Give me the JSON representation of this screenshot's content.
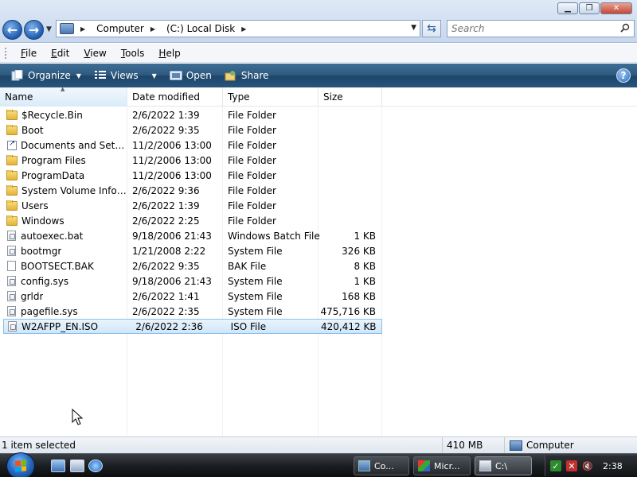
{
  "window": {
    "minimize": "▁",
    "maximize": "❐",
    "close": "✕"
  },
  "address": {
    "crumbs": [
      "Computer",
      "(C:) Local Disk"
    ]
  },
  "search": {
    "placeholder": "Search"
  },
  "menu": {
    "items": [
      {
        "accel": "F",
        "rest": "ile"
      },
      {
        "accel": "E",
        "rest": "dit"
      },
      {
        "accel": "V",
        "rest": "iew"
      },
      {
        "accel": "T",
        "rest": "ools"
      },
      {
        "accel": "H",
        "rest": "elp"
      }
    ]
  },
  "commands": {
    "organize": "Organize",
    "views": "Views",
    "open": "Open",
    "share": "Share",
    "help": "?"
  },
  "columns": {
    "name": "Name",
    "date": "Date modified",
    "type": "Type",
    "size": "Size"
  },
  "files": [
    {
      "name": "$Recycle.Bin",
      "date": "2/6/2022 1:39",
      "type": "File Folder",
      "size": "",
      "icon": "folder"
    },
    {
      "name": "Boot",
      "date": "2/6/2022 9:35",
      "type": "File Folder",
      "size": "",
      "icon": "folder"
    },
    {
      "name": "Documents and Settings",
      "date": "11/2/2006 13:00",
      "type": "File Folder",
      "size": "",
      "icon": "shortcut"
    },
    {
      "name": "Program Files",
      "date": "11/2/2006 13:00",
      "type": "File Folder",
      "size": "",
      "icon": "folder"
    },
    {
      "name": "ProgramData",
      "date": "11/2/2006 13:00",
      "type": "File Folder",
      "size": "",
      "icon": "folder"
    },
    {
      "name": "System Volume Inform...",
      "date": "2/6/2022 9:36",
      "type": "File Folder",
      "size": "",
      "icon": "folder"
    },
    {
      "name": "Users",
      "date": "2/6/2022 1:39",
      "type": "File Folder",
      "size": "",
      "icon": "folder"
    },
    {
      "name": "Windows",
      "date": "2/6/2022 2:25",
      "type": "File Folder",
      "size": "",
      "icon": "folder"
    },
    {
      "name": "autoexec.bat",
      "date": "9/18/2006 21:43",
      "type": "Windows Batch File",
      "size": "1 KB",
      "icon": "sysfile"
    },
    {
      "name": "bootmgr",
      "date": "1/21/2008 2:22",
      "type": "System File",
      "size": "326 KB",
      "icon": "sysfile"
    },
    {
      "name": "BOOTSECT.BAK",
      "date": "2/6/2022 9:35",
      "type": "BAK File",
      "size": "8 KB",
      "icon": "file"
    },
    {
      "name": "config.sys",
      "date": "9/18/2006 21:43",
      "type": "System File",
      "size": "1 KB",
      "icon": "sysfile"
    },
    {
      "name": "grldr",
      "date": "2/6/2022 1:41",
      "type": "System File",
      "size": "168 KB",
      "icon": "sysfile"
    },
    {
      "name": "pagefile.sys",
      "date": "2/6/2022 2:35",
      "type": "System File",
      "size": "475,716 KB",
      "icon": "sysfile"
    },
    {
      "name": "W2AFPP_EN.ISO",
      "date": "2/6/2022 2:36",
      "type": "ISO File",
      "size": "420,412 KB",
      "icon": "sysfile",
      "selected": true
    }
  ],
  "status": {
    "selection": "1 item selected",
    "size": "410 MB",
    "location": "Computer"
  },
  "taskbar": {
    "buttons": [
      {
        "label": "Co...",
        "icon": "computer-icon"
      },
      {
        "label": "Micr...",
        "icon": "paint-icon"
      },
      {
        "label": "C:\\",
        "icon": "drive-icon",
        "active": true
      }
    ],
    "clock": "2:38"
  },
  "colors": {
    "accent": "#2e5a80",
    "selection": "#cfe6fa",
    "folder": "#e3b43a"
  }
}
